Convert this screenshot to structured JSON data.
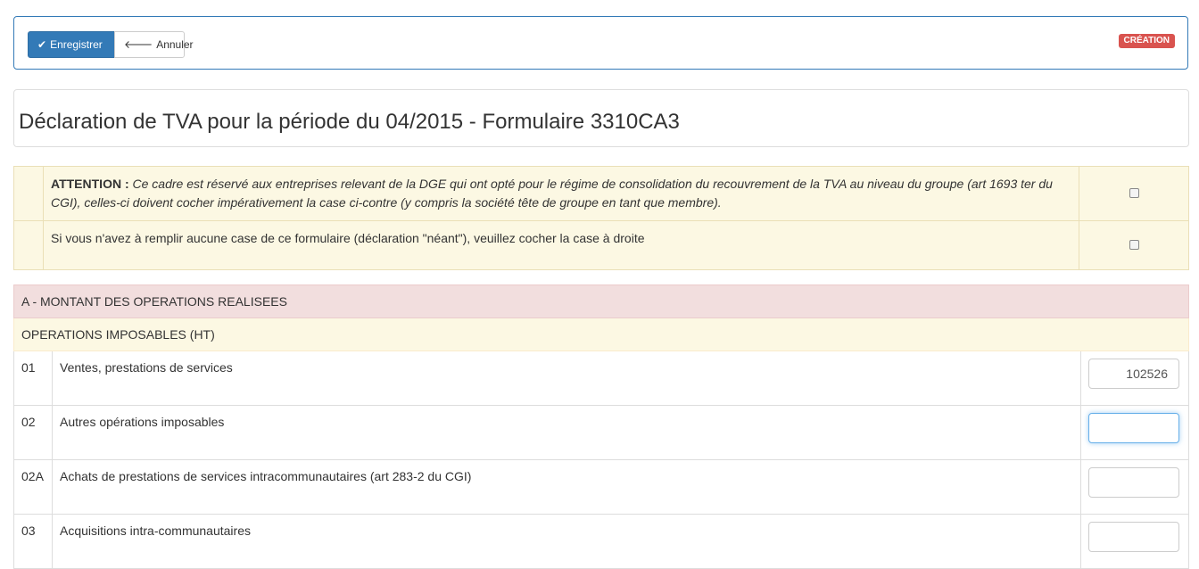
{
  "toolbar": {
    "save_label": "Enregistrer",
    "save_icon": "check-icon",
    "cancel_label": "Annuler",
    "cancel_icon": "arrow-left-icon",
    "status_badge": "CRÉATION",
    "status_color": "#d9534f",
    "accent": "#337ab7"
  },
  "page": {
    "title": "Déclaration de TVA pour la période du 04/2015 - Formulaire 3310CA3"
  },
  "notices": [
    {
      "lead": "ATTENTION :",
      "text": "Ce cadre est réservé aux entreprises relevant de la DGE qui ont opté pour le régime de consolidation du recouvrement de la TVA au niveau du groupe (art 1693 ter du CGI), celles-ci doivent cocher impérativement la case ci-contre (y compris la société tête de groupe en tant que membre).",
      "checked": false
    },
    {
      "text": "Si vous n'avez à remplir aucune case de ce formulaire (déclaration \"néant\"), veuillez cocher la case à droite",
      "checked": false
    }
  ],
  "section": {
    "title": "A - MONTANT DES OPERATIONS REALISEES",
    "subtitle": "OPERATIONS IMPOSABLES (HT)",
    "rows": [
      {
        "code": "01",
        "label": "Ventes, prestations de services",
        "value": "102526"
      },
      {
        "code": "02",
        "label": "Autres opérations imposables",
        "value": ""
      },
      {
        "code": "02A",
        "label": "Achats de prestations de services intracommunautaires (art 283-2 du CGI)",
        "value": ""
      },
      {
        "code": "03",
        "label": "Acquisitions intra-communautaires",
        "value": ""
      }
    ]
  }
}
